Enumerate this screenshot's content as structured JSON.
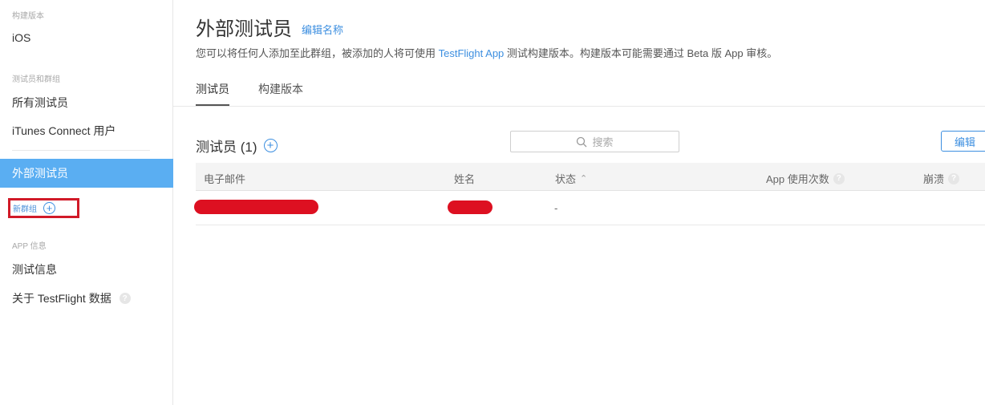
{
  "sidebar": {
    "section_builds": "构建版本",
    "ios": "iOS",
    "section_testers": "测试员和群组",
    "all_testers": "所有测试员",
    "itunes_users": "iTunes Connect 用户",
    "external_testers": "外部测试员",
    "new_group": "新群组",
    "section_app_info": "APP 信息",
    "test_info": "测试信息",
    "about_testflight": "关于 TestFlight 数据"
  },
  "header": {
    "title": "外部测试员",
    "edit_name": "编辑名称",
    "description_before": "您可以将任何人添加至此群组，被添加的人将可使用 ",
    "description_link": "TestFlight App",
    "description_after": " 测试构建版本。构建版本可能需要通过 Beta 版 App 审核。"
  },
  "tabs": [
    {
      "label": "测试员",
      "active": true
    },
    {
      "label": "构建版本",
      "active": false
    }
  ],
  "testers": {
    "title": "测试员 (1)",
    "search_placeholder": "搜索",
    "edit_button": "编辑",
    "columns": {
      "email": "电子邮件",
      "name": "姓名",
      "status": "状态",
      "app_uses": "App 使用次数",
      "crashes": "崩溃"
    },
    "rows": [
      {
        "email": "[redacted]",
        "name": "[redacted]",
        "status": "-"
      }
    ]
  },
  "icons": {
    "plus": "+",
    "help": "?",
    "sort_asc": "⌃",
    "search": "search-icon"
  },
  "colors": {
    "accent": "#3d8fe0",
    "active_bg": "#5aaef2",
    "highlight_red": "#d11a28"
  }
}
